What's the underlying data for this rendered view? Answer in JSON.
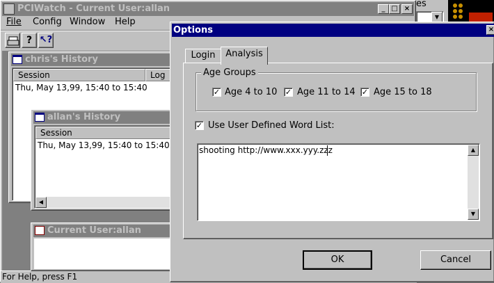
{
  "main_window": {
    "title": "PCIWatch - Current User:allan",
    "menu": [
      "File",
      "Config",
      "Window",
      "Help"
    ],
    "status_text": "For Help, press F1"
  },
  "right_bg": {
    "fragment_text": "es"
  },
  "windows": {
    "chris": {
      "title": "chris's History",
      "col_session": "Session",
      "col_log": "Log",
      "row1": "Thu, May 13,99, 15:40 to 15:40"
    },
    "allan": {
      "title": "allan's History",
      "col_session": "Session",
      "row1": "Thu, May 13,99, 15:40 to 15:40"
    },
    "current": {
      "title": "Current User:allan"
    }
  },
  "dialog": {
    "title": "Options",
    "close_glyph": "×",
    "tabs": [
      "Login",
      "Analysis"
    ],
    "age_group_title": "Age Groups",
    "age_groups": [
      {
        "label": "Age 4 to 10",
        "checked": true
      },
      {
        "label": "Age 11 to 14",
        "checked": true
      },
      {
        "label": "Age 15 to 18",
        "checked": true
      }
    ],
    "use_word_list_label": "Use User Defined Word List:",
    "use_word_list_checked": true,
    "word_list_text": "shooting http://www.xxx.yyy.zzz",
    "ok_label": "OK",
    "cancel_label": "Cancel"
  }
}
